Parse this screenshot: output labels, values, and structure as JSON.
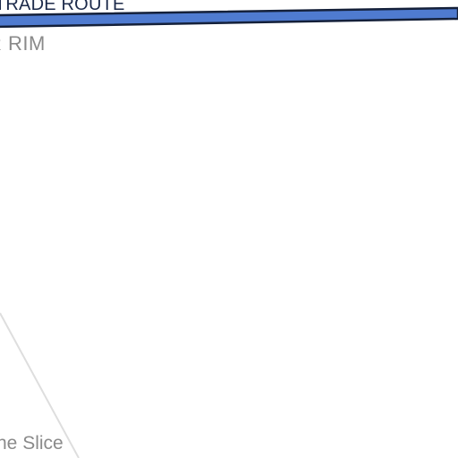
{
  "map": {
    "background_color": "#ffffff",
    "route": {
      "label": "TRADE ROUTE",
      "fill_color": "#4f7bd0",
      "outline_color": "#14203a",
      "label_color": "#1c2a4a"
    },
    "region": {
      "label": "R RIM",
      "color": "#8a8a8a"
    },
    "boundary": {
      "color": "#dedede"
    },
    "place": {
      "label": "ne Slice",
      "color": "#8a8a8a"
    }
  }
}
